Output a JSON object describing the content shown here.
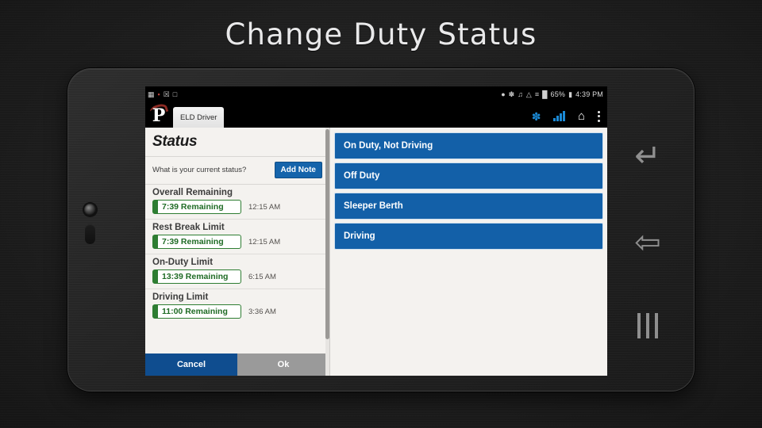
{
  "slide": {
    "title": "Change Duty Status"
  },
  "device": {
    "statusbar": {
      "left_icons": [
        "chart-icon",
        "message-icon",
        "mail-icon",
        "square-icon"
      ],
      "right_icons": [
        "location-icon",
        "bluetooth-icon",
        "mute-icon",
        "wifi-icon",
        "nfc-icon",
        "signal-icon"
      ],
      "battery": "65%",
      "time": "4:39 PM"
    },
    "appbar": {
      "logo": "p-logo-icon",
      "tab_label": "ELD Driver",
      "actions": [
        {
          "name": "bluetooth-icon",
          "glyph": "ᛗ"
        },
        {
          "name": "signal-icon"
        },
        {
          "name": "home-icon",
          "glyph": "⌂"
        },
        {
          "name": "overflow-menu-icon"
        }
      ]
    },
    "navbar": {
      "undo": "undo-icon",
      "back": "back-icon",
      "menu": "recent-apps-icon"
    }
  },
  "status_panel": {
    "heading": "Status",
    "question": "What is your current status?",
    "add_note_label": "Add Note",
    "limits": [
      {
        "title": "Overall Remaining",
        "badge": "7:39 Remaining",
        "time": "12:15 AM"
      },
      {
        "title": "Rest Break Limit",
        "badge": "7:39 Remaining",
        "time": "12:15 AM"
      },
      {
        "title": "On-Duty Limit",
        "badge": "13:39 Remaining",
        "time": "6:15 AM"
      },
      {
        "title": "Driving Limit",
        "badge": "11:00 Remaining",
        "time": "3:36 AM"
      }
    ],
    "cancel_label": "Cancel",
    "ok_label": "Ok"
  },
  "duty_options": [
    {
      "label": "On Duty, Not Driving"
    },
    {
      "label": "Off Duty"
    },
    {
      "label": "Sleeper Berth"
    },
    {
      "label": "Driving"
    }
  ],
  "colors": {
    "accent_blue": "#1360a8",
    "cancel_blue": "#0f4d8f",
    "ok_gray": "#9a9a9a",
    "badge_green": "#2e7d32",
    "panel_bg": "#f4f2ef"
  }
}
